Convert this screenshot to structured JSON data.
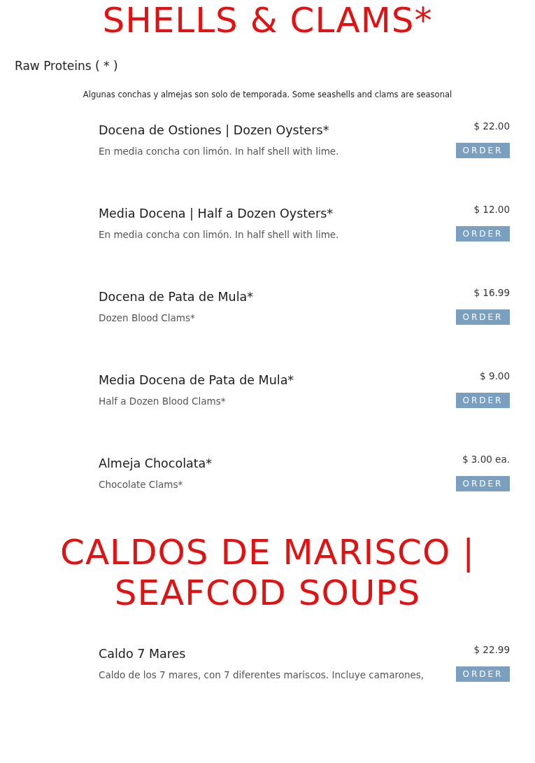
{
  "sections": [
    {
      "title": "SHELLS & CLAMS*",
      "subtitle": "Raw Proteins ( * )",
      "note": "Algunas conchas y almejas son solo de temporada. Some seashells and clams are seasonal",
      "items": [
        {
          "name": "Docena de Ostiones | Dozen Oysters*",
          "description": "En media concha con limón. In half shell with lime.",
          "price": "$ 22.00",
          "button": "ORDER"
        },
        {
          "name": "Media Docena | Half a Dozen Oysters*",
          "description": "En media concha con limón. In half shell with lime.",
          "price": "$ 12.00",
          "button": "ORDER"
        },
        {
          "name": "Docena de Pata de Mula*",
          "description": "Dozen Blood Clams*",
          "price": "$ 16.99",
          "button": "ORDER"
        },
        {
          "name": "Media Docena de Pata de Mula*",
          "description": "Half a Dozen Blood Clams*",
          "price": "$ 9.00",
          "button": "ORDER"
        },
        {
          "name": "Almeja Chocolata*",
          "description": "Chocolate Clams*",
          "price": "$ 3.00 ea.",
          "button": "ORDER"
        }
      ]
    },
    {
      "title": "CALDOS DE MARISCO | SEAFCOD SOUPS",
      "items": [
        {
          "name": "Caldo 7 Mares",
          "description": "Caldo de los 7 mares, con 7 diferentes mariscos. Incluye camarones,",
          "price": "$ 22.99",
          "button": "ORDER"
        }
      ]
    }
  ]
}
